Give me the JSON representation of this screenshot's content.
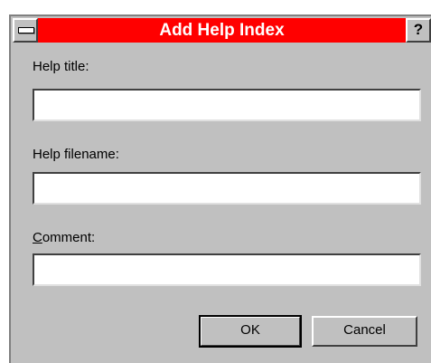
{
  "window": {
    "title": "Add Help Index",
    "help_glyph": "?",
    "system_menu_icon": "system-menu-bar",
    "title_bar_color": "#ff0000",
    "face_color": "#c0c0c0"
  },
  "form": {
    "help_title_label": "Help title:",
    "help_title_value": "",
    "help_filename_label": "Help filename:",
    "help_filename_value": "",
    "comment_label": "Comment:",
    "comment_value": ""
  },
  "buttons": {
    "ok_label": "OK",
    "cancel_label": "Cancel"
  }
}
